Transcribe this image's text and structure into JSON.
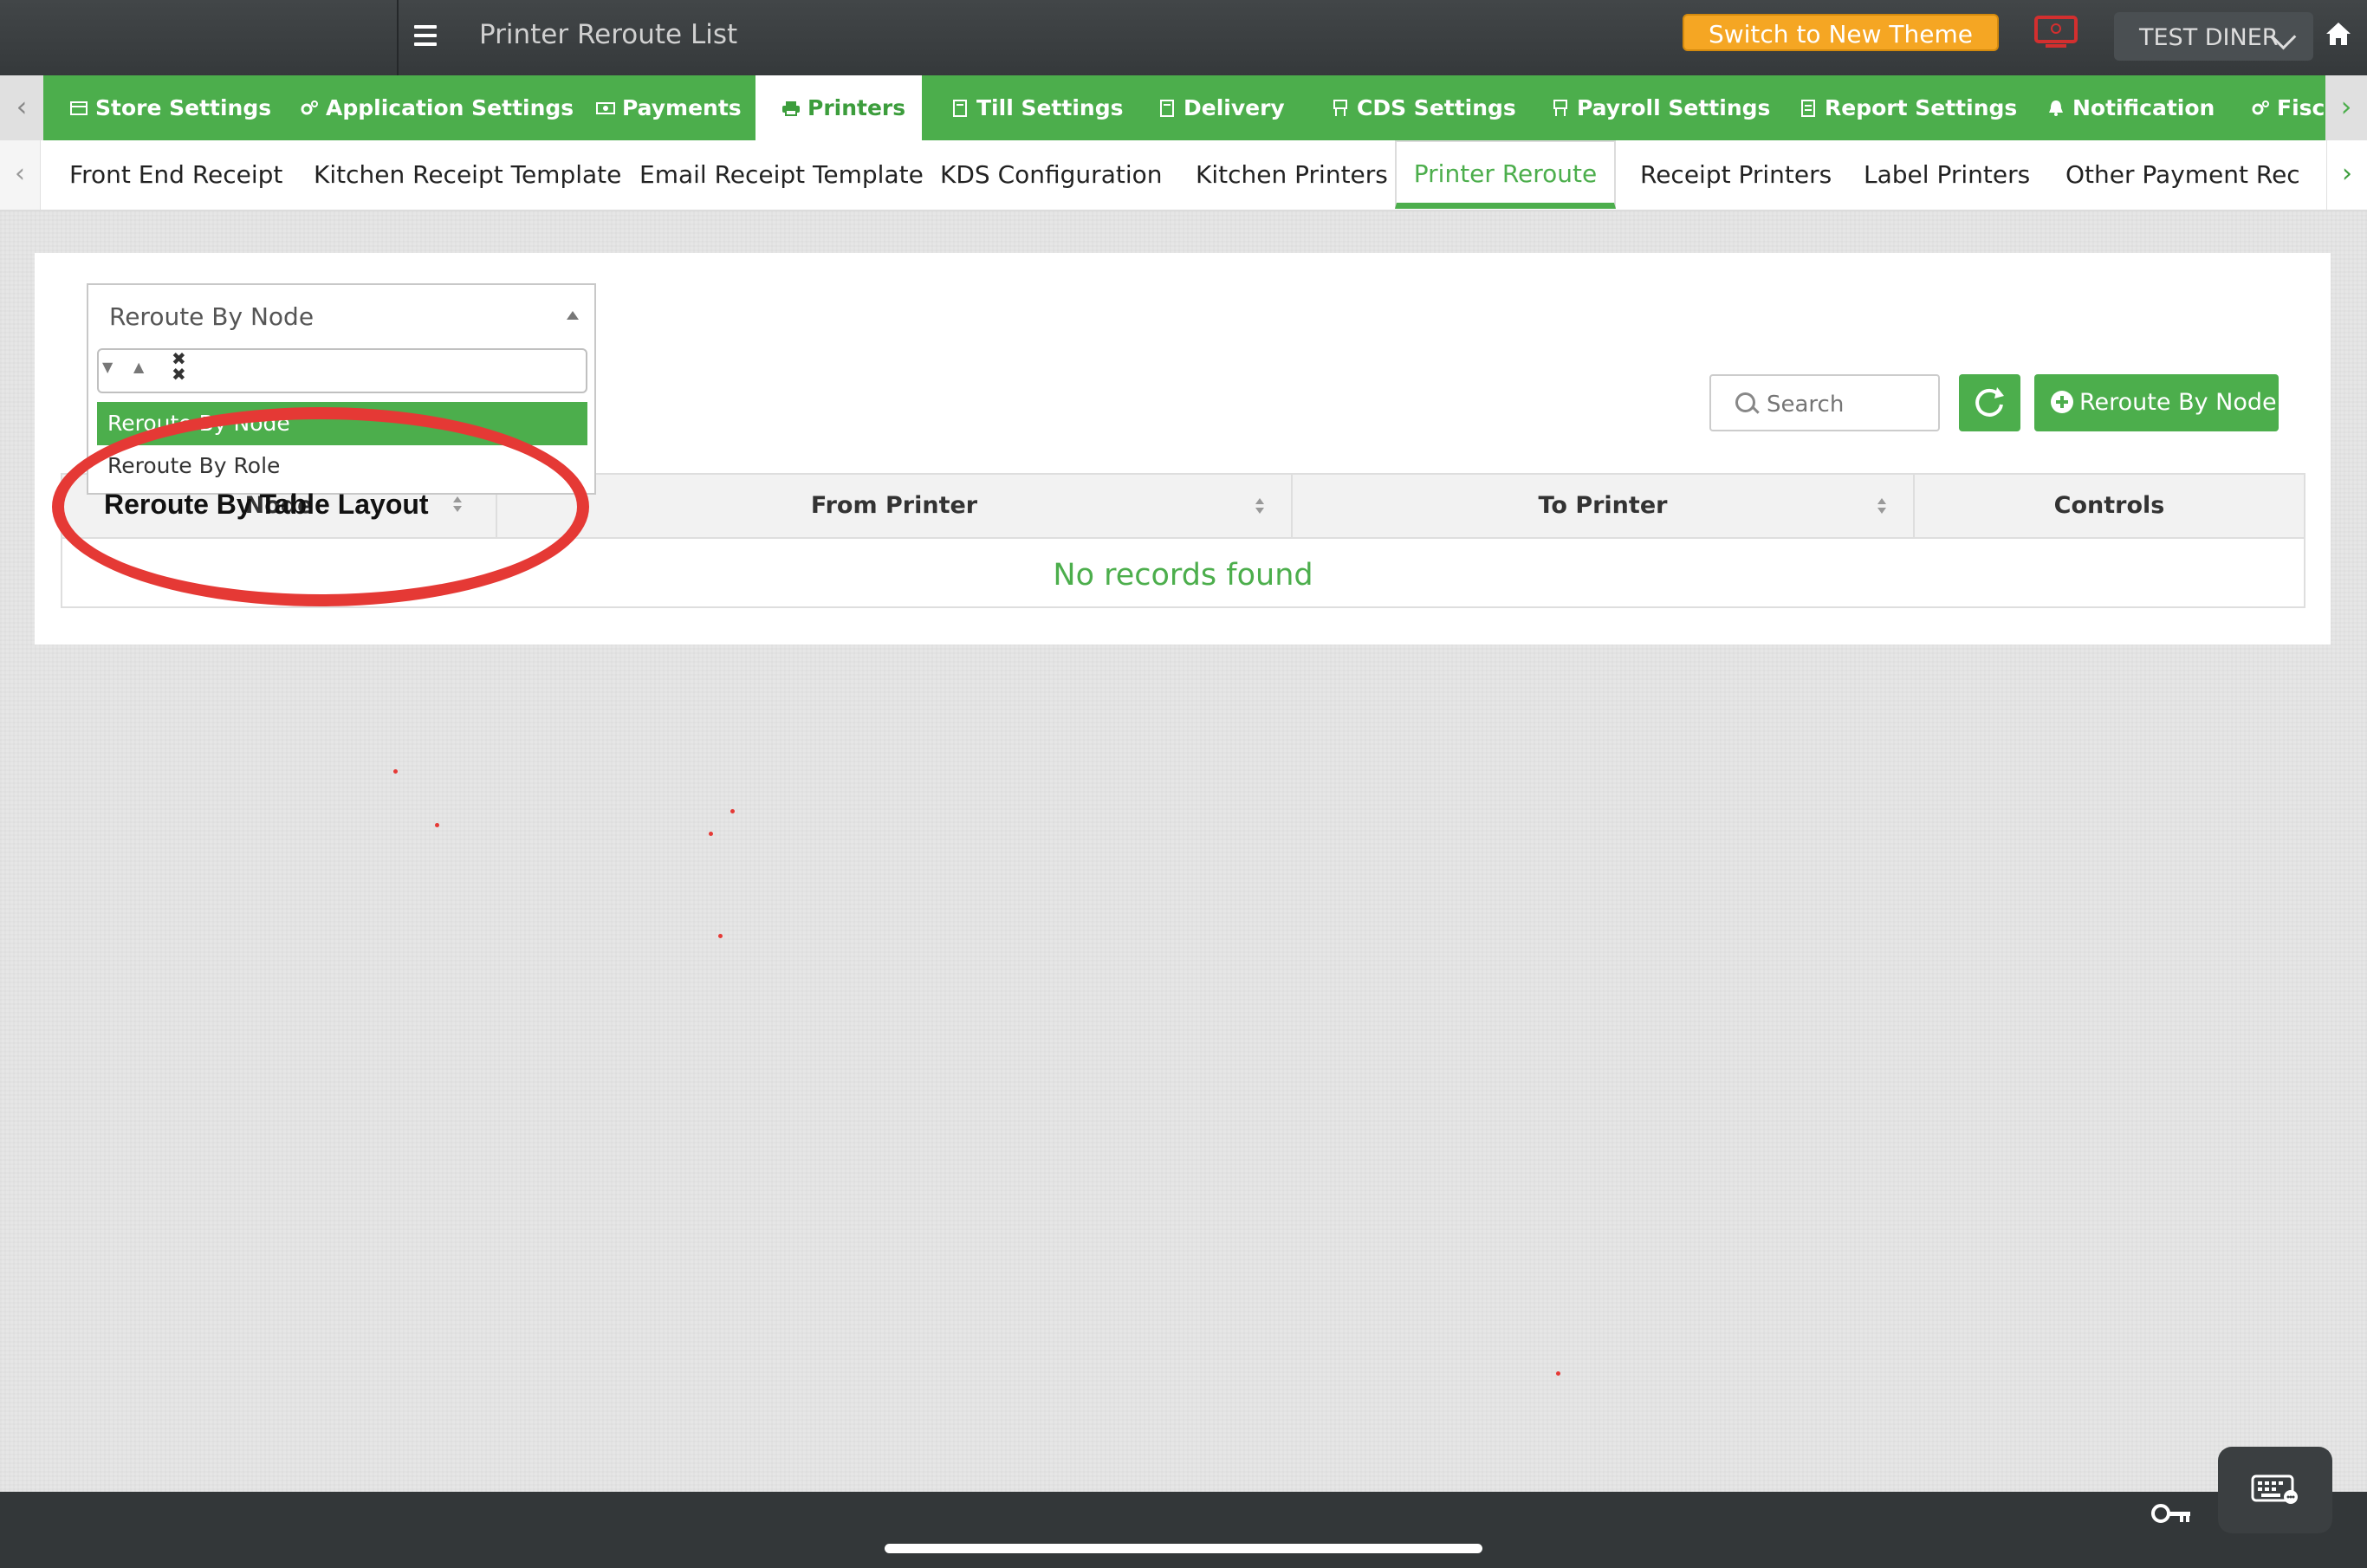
{
  "topbar": {
    "page_title": "Printer Reroute List",
    "switch_theme": "Switch to New Theme",
    "user": "TEST DINER"
  },
  "main_tabs": [
    {
      "label": "Store Settings",
      "icon": "store-icon"
    },
    {
      "label": "Application Settings",
      "icon": "gears-icon"
    },
    {
      "label": "Payments",
      "icon": "money-icon"
    },
    {
      "label": "Printers",
      "icon": "printer-icon",
      "active": true
    },
    {
      "label": "Till Settings",
      "icon": "calculator-icon"
    },
    {
      "label": "Delivery",
      "icon": "calculator-icon"
    },
    {
      "label": "CDS Settings",
      "icon": "display-icon"
    },
    {
      "label": "Payroll Settings",
      "icon": "display-icon"
    },
    {
      "label": "Report Settings",
      "icon": "report-icon"
    },
    {
      "label": "Notification",
      "icon": "bell-icon"
    },
    {
      "label": "Fisc",
      "icon": "gears-icon"
    }
  ],
  "sub_tabs": [
    {
      "label": "Front End Receipt"
    },
    {
      "label": "Kitchen Receipt Template"
    },
    {
      "label": "Email Receipt Template"
    },
    {
      "label": "KDS Configuration"
    },
    {
      "label": "Kitchen Printers"
    },
    {
      "label": "Printer Reroute",
      "active": true
    },
    {
      "label": "Receipt Printers"
    },
    {
      "label": "Label Printers"
    },
    {
      "label": "Other Payment Receip"
    }
  ],
  "dropdown": {
    "value": "Reroute By Node",
    "options": [
      "Reroute By Node",
      "Reroute By Role",
      "Reroute By Table Layout"
    ]
  },
  "toolbar": {
    "search_placeholder": "Search",
    "add_label": "Reroute By Node"
  },
  "table": {
    "columns": [
      "Node",
      "From Printer",
      "To Printer",
      "Controls"
    ],
    "empty_text": "No records found"
  },
  "colors": {
    "accent_green": "#4cae4c",
    "switch_orange": "#f5a623",
    "annotation_red": "#e53935"
  }
}
